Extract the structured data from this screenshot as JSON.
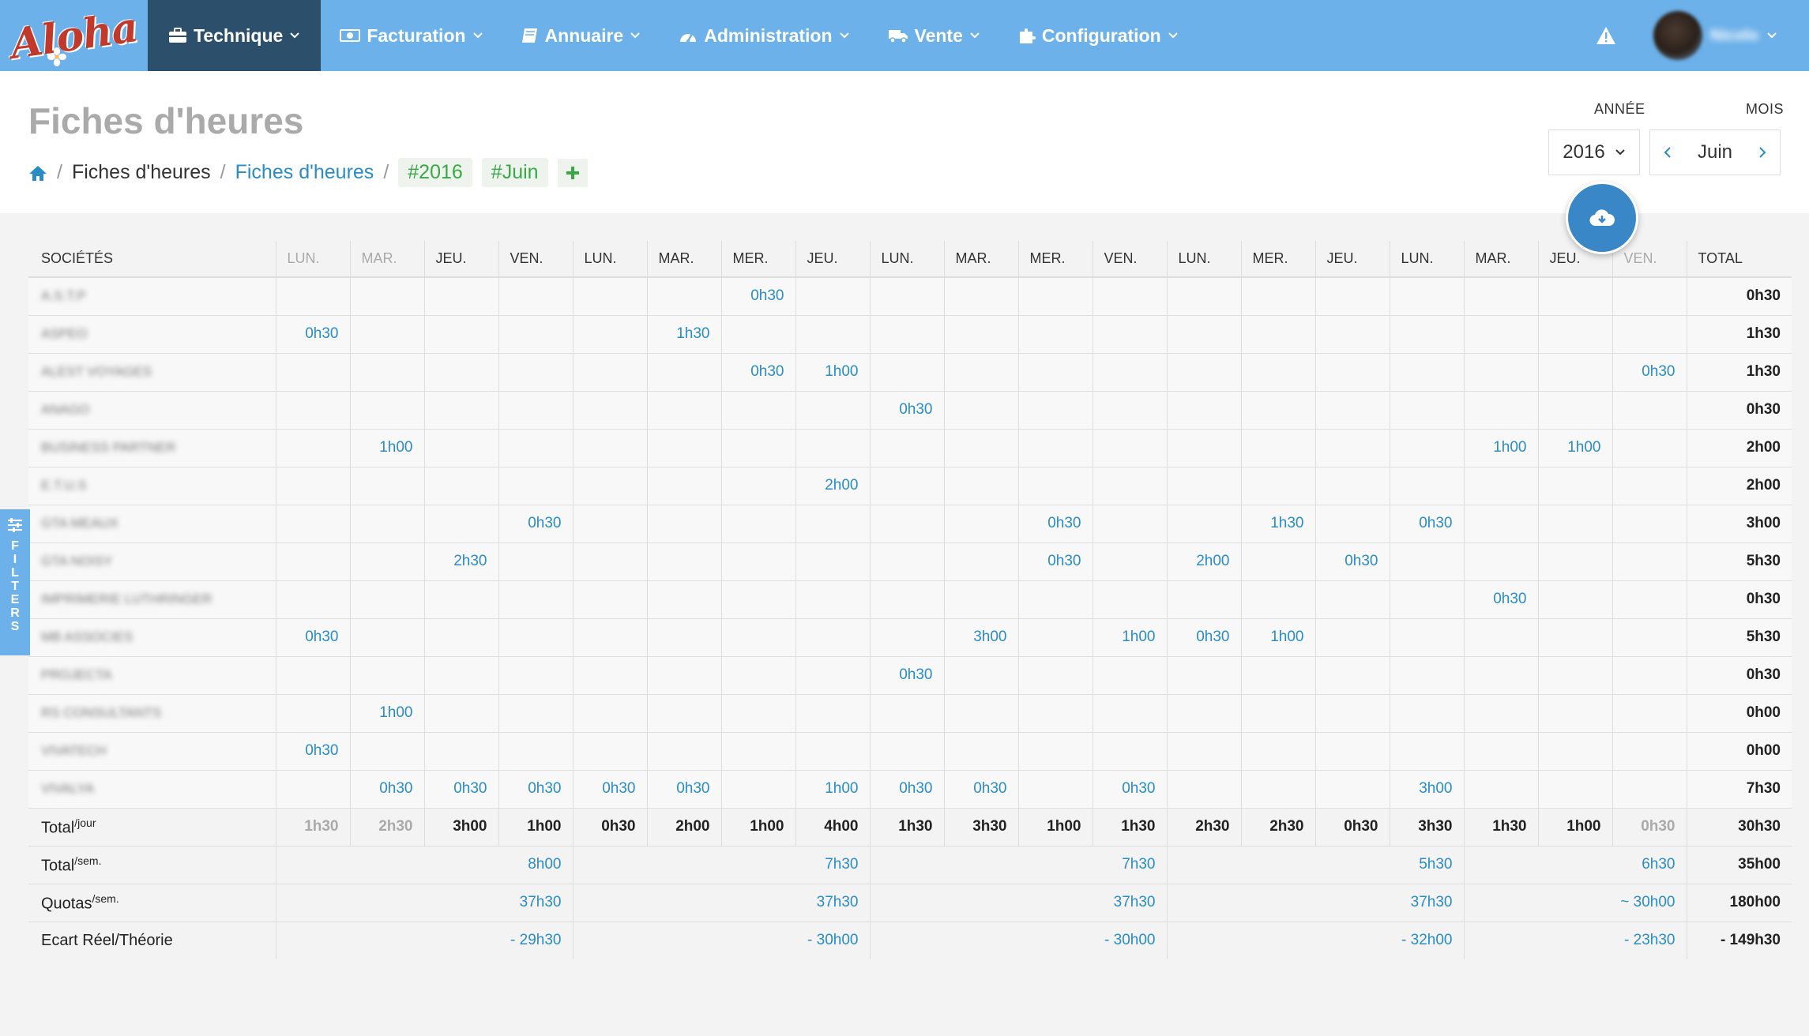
{
  "logo": {
    "text": "Aloha"
  },
  "nav": {
    "items": [
      {
        "label": "Technique",
        "icon": "briefcase-icon",
        "active": true
      },
      {
        "label": "Facturation",
        "icon": "money-icon"
      },
      {
        "label": "Annuaire",
        "icon": "book-icon"
      },
      {
        "label": "Administration",
        "icon": "dashboard-icon"
      },
      {
        "label": "Vente",
        "icon": "truck-icon"
      },
      {
        "label": "Configuration",
        "icon": "puzzle-icon"
      }
    ],
    "user_name": "Nicolo"
  },
  "header": {
    "title": "Fiches d'heures",
    "breadcrumb": {
      "home_icon": "home-icon",
      "item1": "Fiches d'heures",
      "item2": "Fiches d'heures",
      "tag_year": "#2016",
      "tag_month": "#Juin"
    },
    "year_label": "ANNÉE",
    "month_label": "MOIS",
    "year_value": "2016",
    "month_value": "Juin"
  },
  "filters_label": "FILTERS",
  "table": {
    "headers": [
      "SOCIÉTÉS",
      "LUN.",
      "MAR.",
      "JEU.",
      "VEN.",
      "LUN.",
      "MAR.",
      "MER.",
      "JEU.",
      "LUN.",
      "MAR.",
      "MER.",
      "VEN.",
      "LUN.",
      "MER.",
      "JEU.",
      "LUN.",
      "MAR.",
      "JEU.",
      "VEN.",
      "TOTAL"
    ],
    "dim_headers": [
      1,
      2,
      19
    ],
    "rows": [
      {
        "name": "A.S.T.P",
        "cells": [
          "",
          "",
          "",
          "",
          "",
          "",
          "0h30",
          "",
          "",
          "",
          "",
          "",
          "",
          "",
          "",
          "",
          "",
          "",
          ""
        ],
        "total": "0h30"
      },
      {
        "name": "ASPEO",
        "cells": [
          "0h30",
          "",
          "",
          "",
          "",
          "1h30",
          "",
          "",
          "",
          "",
          "",
          "",
          "",
          "",
          "",
          "",
          "",
          "",
          ""
        ],
        "total": "1h30"
      },
      {
        "name": "ALEST VOYAGES",
        "cells": [
          "",
          "",
          "",
          "",
          "",
          "",
          "0h30",
          "1h00",
          "",
          "",
          "",
          "",
          "",
          "",
          "",
          "",
          "",
          "",
          "0h30"
        ],
        "total": "1h30"
      },
      {
        "name": "ANAGO",
        "cells": [
          "",
          "",
          "",
          "",
          "",
          "",
          "",
          "",
          "0h30",
          "",
          "",
          "",
          "",
          "",
          "",
          "",
          "",
          "",
          ""
        ],
        "total": "0h30"
      },
      {
        "name": "BUSINESS PARTNER",
        "cells": [
          "",
          "1h00",
          "",
          "",
          "",
          "",
          "",
          "",
          "",
          "",
          "",
          "",
          "",
          "",
          "",
          "",
          "1h00",
          "1h00",
          ""
        ],
        "total": "2h00"
      },
      {
        "name": "E.T.U.S",
        "cells": [
          "",
          "",
          "",
          "",
          "",
          "",
          "",
          "2h00",
          "",
          "",
          "",
          "",
          "",
          "",
          "",
          "",
          "",
          "",
          ""
        ],
        "total": "2h00"
      },
      {
        "name": "GTA MEAUX",
        "cells": [
          "",
          "",
          "",
          "0h30",
          "",
          "",
          "",
          "",
          "",
          "",
          "0h30",
          "",
          "",
          "1h30",
          "",
          "0h30",
          "",
          "",
          ""
        ],
        "total": "3h00"
      },
      {
        "name": "GTA NOISY",
        "cells": [
          "",
          "",
          "2h30",
          "",
          "",
          "",
          "",
          "",
          "",
          "",
          "0h30",
          "",
          "2h00",
          "",
          "0h30",
          "",
          "",
          "",
          ""
        ],
        "total": "5h30"
      },
      {
        "name": "IMPRIMERIE LUTHRINGER",
        "cells": [
          "",
          "",
          "",
          "",
          "",
          "",
          "",
          "",
          "",
          "",
          "",
          "",
          "",
          "",
          "",
          "",
          "0h30",
          "",
          ""
        ],
        "total": "0h30"
      },
      {
        "name": "MB ASSOCIES",
        "cells": [
          "0h30",
          "",
          "",
          "",
          "",
          "",
          "",
          "",
          "",
          "3h00",
          "",
          "1h00",
          "0h30",
          "1h00",
          "",
          "",
          "",
          "",
          ""
        ],
        "total": "5h30"
      },
      {
        "name": "PROJECTA",
        "cells": [
          "",
          "",
          "",
          "",
          "",
          "",
          "",
          "",
          "0h30",
          "",
          "",
          "",
          "",
          "",
          "",
          "",
          "",
          "",
          ""
        ],
        "total": "0h30"
      },
      {
        "name": "RS CONSULTANTS",
        "cells": [
          "",
          "1h00",
          "",
          "",
          "",
          "",
          "",
          "",
          "",
          "",
          "",
          "",
          "",
          "",
          "",
          "",
          "",
          "",
          ""
        ],
        "total": "0h00"
      },
      {
        "name": "VIVATECH",
        "cells": [
          "0h30",
          "",
          "",
          "",
          "",
          "",
          "",
          "",
          "",
          "",
          "",
          "",
          "",
          "",
          "",
          "",
          "",
          "",
          ""
        ],
        "total": "0h00"
      },
      {
        "name": "VIVALYA",
        "cells": [
          "",
          "0h30",
          "0h30",
          "0h30",
          "0h30",
          "0h30",
          "",
          "1h00",
          "0h30",
          "0h30",
          "",
          "0h30",
          "",
          "",
          "",
          "3h00",
          "",
          "",
          ""
        ],
        "total": "7h30"
      }
    ],
    "total_day": {
      "label": "Total",
      "sup": "/jour",
      "cells": [
        "1h30",
        "2h30",
        "3h00",
        "1h00",
        "0h30",
        "2h00",
        "1h00",
        "4h00",
        "1h30",
        "3h30",
        "1h00",
        "1h30",
        "2h30",
        "2h30",
        "0h30",
        "3h30",
        "1h30",
        "1h00",
        "0h30"
      ],
      "dim": [
        0,
        1,
        18
      ],
      "total": "30h30"
    },
    "total_week": {
      "label": "Total",
      "sup": "/sem.",
      "weeks": [
        "8h00",
        "7h30",
        "7h30",
        "5h30",
        "6h30"
      ],
      "total": "35h00"
    },
    "quotas": {
      "label": "Quotas",
      "sup": "/sem.",
      "weeks": [
        "37h30",
        "37h30",
        "37h30",
        "37h30",
        "~ 30h00"
      ],
      "total": "180h00"
    },
    "ecart": {
      "label": "Ecart Réel/Théorie",
      "weeks": [
        "- 29h30",
        "- 30h00",
        "- 30h00",
        "- 32h00",
        "- 23h30"
      ],
      "total": "- 149h30"
    }
  }
}
